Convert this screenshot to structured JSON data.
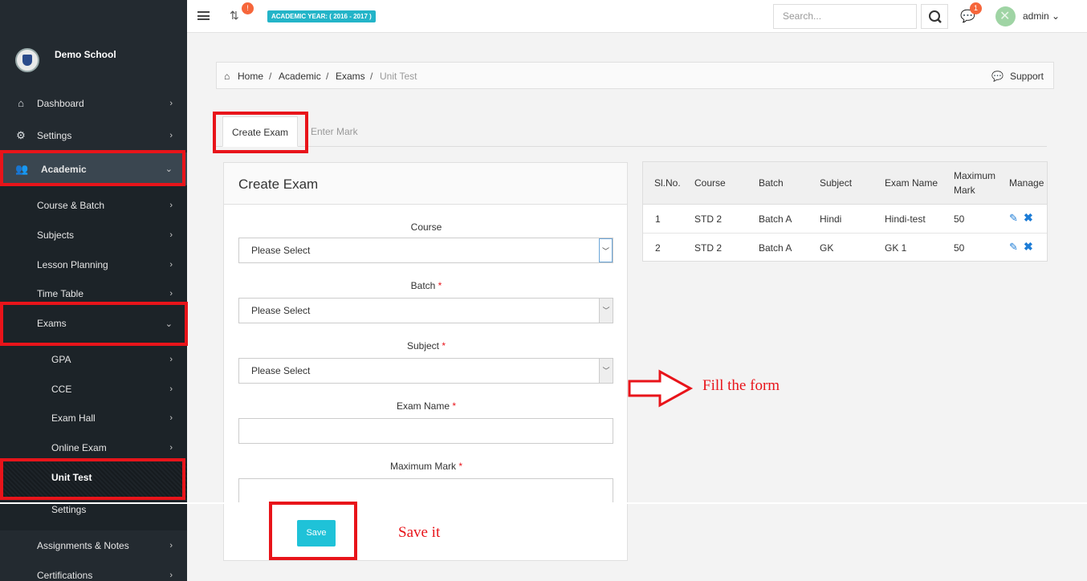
{
  "brand": {
    "school": "Demo School"
  },
  "sidebar": {
    "items": [
      {
        "label": "Dashboard",
        "icon": "home-icon"
      },
      {
        "label": "Settings",
        "icon": "gears-icon"
      },
      {
        "label": "Academic",
        "icon": "users-icon"
      }
    ],
    "academic_sub": [
      {
        "label": "Course & Batch"
      },
      {
        "label": "Subjects"
      },
      {
        "label": "Lesson Planning"
      },
      {
        "label": "Time Table"
      },
      {
        "label": "Exams"
      }
    ],
    "exams_sub": [
      {
        "label": "GPA"
      },
      {
        "label": "CCE"
      },
      {
        "label": "Exam Hall"
      },
      {
        "label": "Online Exam"
      },
      {
        "label": "Unit Test"
      },
      {
        "label": "Settings"
      }
    ],
    "more": [
      {
        "label": "Assignments & Notes"
      },
      {
        "label": "Certifications"
      }
    ]
  },
  "topbar": {
    "sync_badge": "!",
    "academic_year": "ACADEMIC YEAR: ( 2016 - 2017 )",
    "search_placeholder": "Search...",
    "chat_badge": "1",
    "user": "admin"
  },
  "breadcrumb": {
    "home": "Home",
    "academic": "Academic",
    "exams": "Exams",
    "current": "Unit Test",
    "sep": "/",
    "support": "Support"
  },
  "tabs": {
    "create": "Create Exam",
    "enter": "Enter Mark"
  },
  "form": {
    "title": "Create Exam",
    "course_label": "Course",
    "course_value": "Please Select",
    "batch_label": "Batch",
    "batch_value": "Please Select",
    "subject_label": "Subject",
    "subject_value": "Please Select",
    "exam_name_label": "Exam Name",
    "max_mark_label": "Maximum Mark",
    "required_mark": "*",
    "save": "Save"
  },
  "table": {
    "headers": [
      "Sl.No.",
      "Course",
      "Batch",
      "Subject",
      "Exam Name",
      "Maximum",
      "Mark",
      "Manage"
    ],
    "rows": [
      [
        "1",
        "STD 2",
        "Batch A",
        "Hindi",
        "Hindi-test",
        "50"
      ],
      [
        "2",
        "STD 2",
        "Batch A",
        "GK",
        "GK 1",
        "50"
      ]
    ]
  },
  "annotations": {
    "fill": "Fill the form",
    "save": "Save it"
  }
}
